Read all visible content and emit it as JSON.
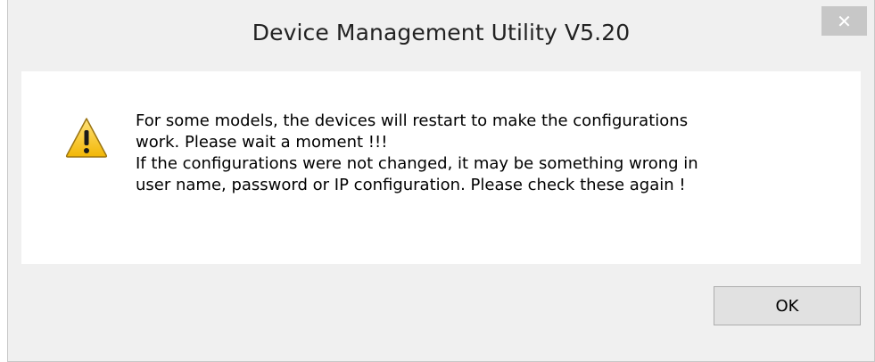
{
  "dialog": {
    "title": "Device Management Utility V5.20",
    "close_label": "✕",
    "icon": "warning-icon",
    "message_line1": "For some models, the devices will restart to make the configurations\nwork. Please wait a moment !!!",
    "message_line2": "If the configurations were not changed, it may be something wrong in\nuser name, password or IP configuration. Please check these again !",
    "ok_label": "OK"
  },
  "colors": {
    "warning_fill": "#f7c531",
    "warning_stroke": "#8a6a10",
    "close_bg": "#c7c7c7"
  }
}
